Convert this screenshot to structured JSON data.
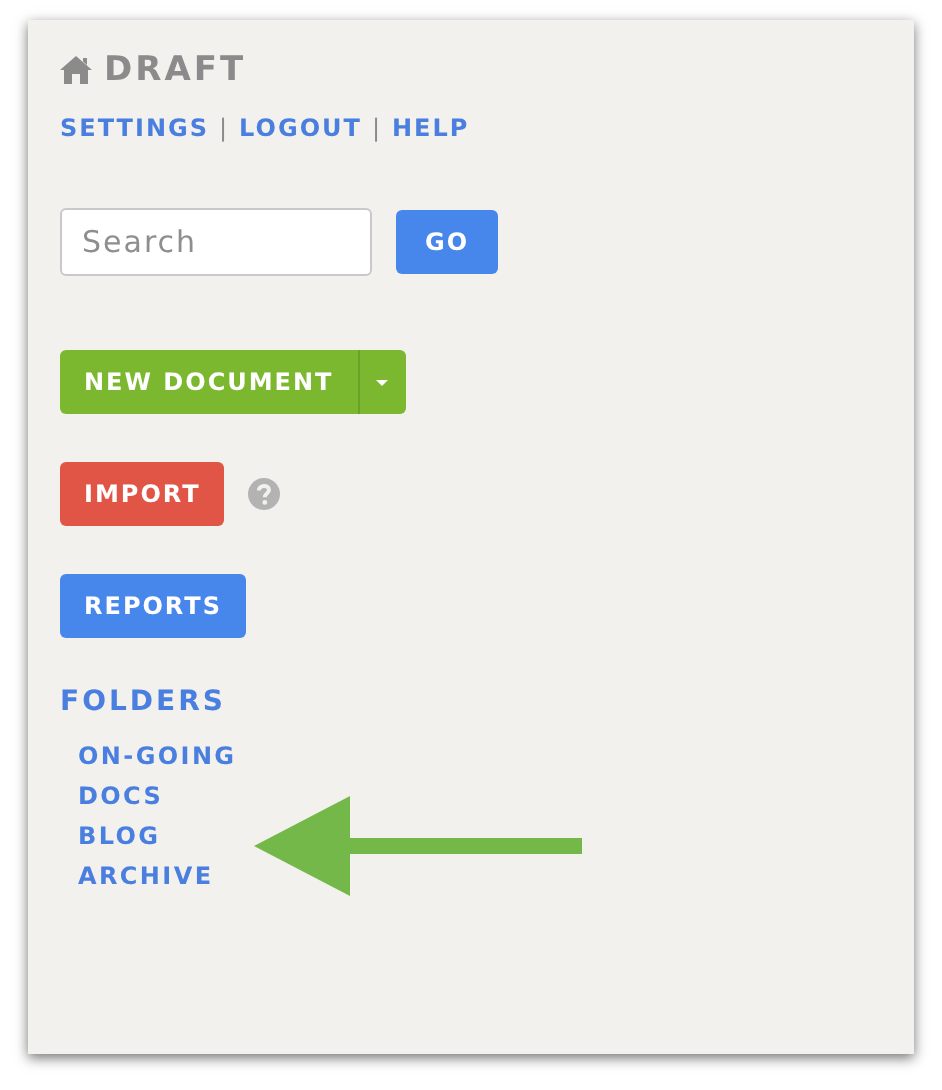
{
  "header": {
    "title": "DRAFT"
  },
  "nav": [
    {
      "kind": "link",
      "label": "SETTINGS"
    },
    {
      "kind": "separator",
      "label": "|"
    },
    {
      "kind": "link",
      "label": "LOGOUT"
    },
    {
      "kind": "separator",
      "label": "|"
    },
    {
      "kind": "link",
      "label": "HELP"
    }
  ],
  "search": {
    "placeholder": "Search",
    "button": "GO"
  },
  "actions": [
    {
      "kind": "split",
      "label": "NEW DOCUMENT",
      "color": "#7cb82f"
    },
    {
      "kind": "help",
      "label": "IMPORT",
      "color": "#e05546"
    },
    {
      "kind": "plain",
      "label": "REPORTS",
      "color": "#4787ec"
    }
  ],
  "folders": {
    "title": "FOLDERS",
    "items": [
      "ON-GOING",
      "DOCS",
      "BLOG",
      "ARCHIVE"
    ]
  }
}
